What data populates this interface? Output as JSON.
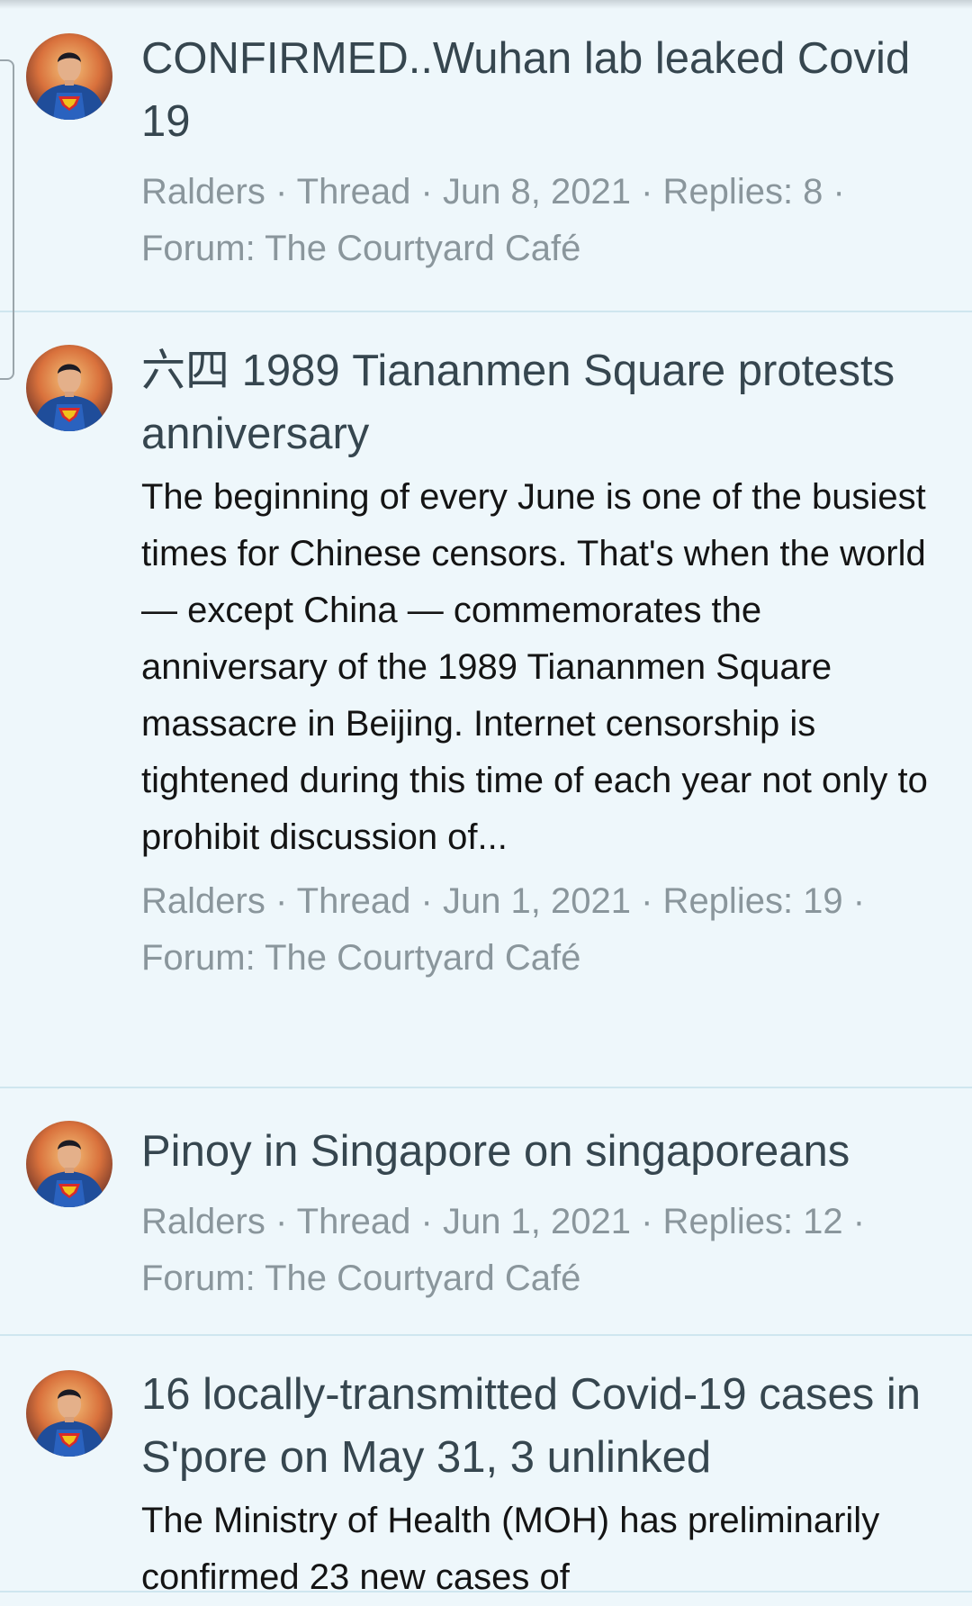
{
  "results": [
    {
      "title": "CONFIRMED..Wuhan lab leaked Covid 19",
      "snippet": "",
      "meta_line1": "Ralders · Thread · Jun 8, 2021 · Replies: 8 ·",
      "meta_line2": "Forum: The Courtyard Café"
    },
    {
      "title": "六四 1989 Tiananmen Square protests anniversary",
      "snippet": "The beginning of every June is one of the busiest times for Chinese censors. That's when the world — except China — commemorates the anniversary of the 1989 Tiananmen Square massacre in Beijing. Internet censorship is tightened during this time of each year not only to prohibit discussion of...",
      "meta_line1": "Ralders · Thread · Jun 1, 2021 · Replies: 19 ·",
      "meta_line2": "Forum: The Courtyard Café"
    },
    {
      "title": "Pinoy in Singapore on singaporeans",
      "snippet": "",
      "meta_line1": "Ralders · Thread · Jun 1, 2021 · Replies: 12 ·",
      "meta_line2": "Forum: The Courtyard Café"
    },
    {
      "title": "16 locally-transmitted Covid-19 cases in S'pore on May 31, 3 unlinked",
      "snippet": "The Ministry of Health (MOH) has preliminarily confirmed 23 new cases of",
      "meta_line1": "",
      "meta_line2": ""
    }
  ],
  "avatar_icon": "superhero-avatar",
  "colors": {
    "background": "#eef7fb",
    "title": "#36464f",
    "meta": "#8a969c",
    "divider": "#cfe6ef"
  }
}
